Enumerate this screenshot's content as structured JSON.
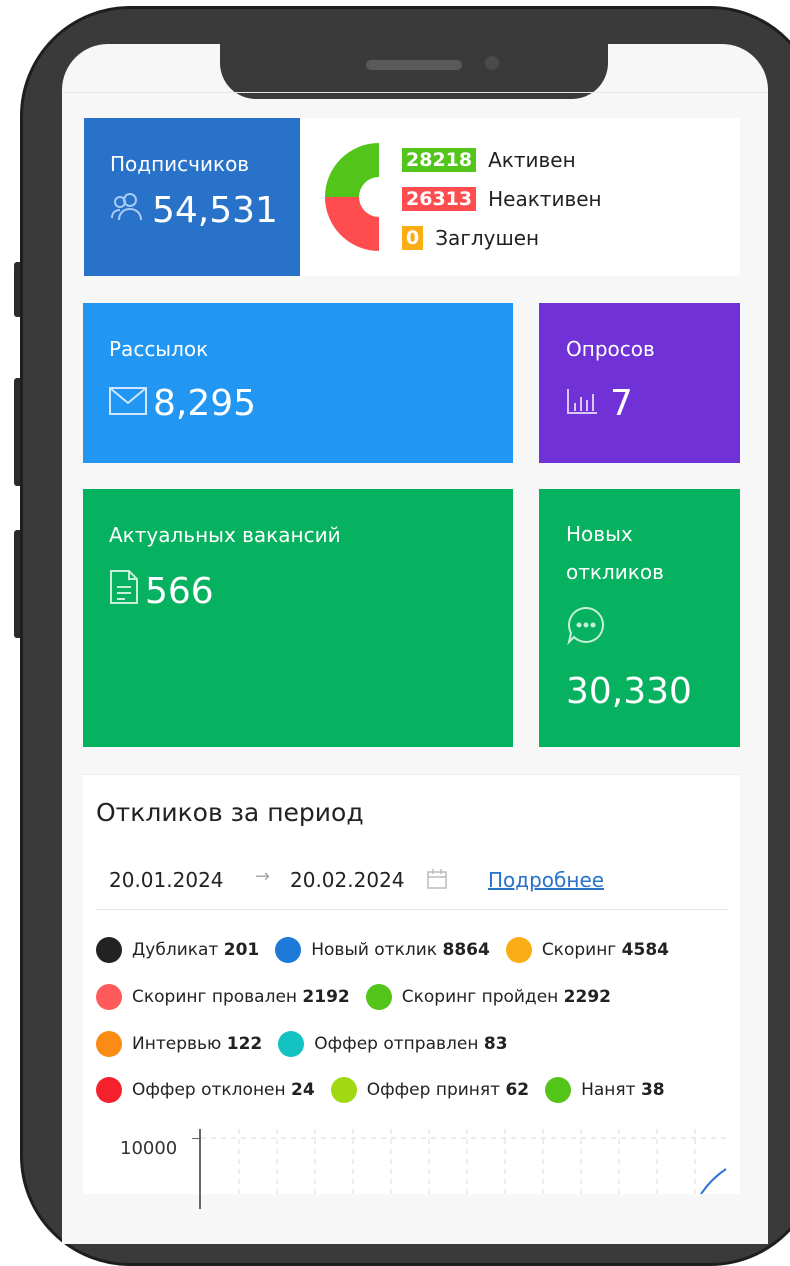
{
  "subscribers": {
    "label": "Подписчиков",
    "value": "54,531"
  },
  "subscriber_status": [
    {
      "value": "28218",
      "label": "Активен",
      "color": "#52c41a"
    },
    {
      "value": "26313",
      "label": "Неактивен",
      "color": "#ff4d4f"
    },
    {
      "value": "0",
      "label": "Заглушен",
      "color": "#faad14"
    }
  ],
  "mailings": {
    "label": "Рассылок",
    "value": "8,295"
  },
  "polls": {
    "label": "Опросов",
    "value": "7"
  },
  "vacancies": {
    "label": "Актуальных вакансий",
    "value": "566"
  },
  "responses": {
    "label_line1": "Новых",
    "label_line2": "откликов",
    "value": "30,330"
  },
  "period": {
    "title": "Откликов за период",
    "date_from": "20.01.2024",
    "date_to": "20.02.2024",
    "more_link": "Подробнее"
  },
  "response_stats": [
    {
      "label": "Дубликат",
      "value": "201",
      "color": "#222222"
    },
    {
      "label": "Новый отклик",
      "value": "8864",
      "color": "#1e7ad8"
    },
    {
      "label": "Скоринг",
      "value": "4584",
      "color": "#faad14"
    },
    {
      "label": "Скоринг провален",
      "value": "2192",
      "color": "#ff5a5a"
    },
    {
      "label": "Скоринг пройден",
      "value": "2292",
      "color": "#52c41a"
    },
    {
      "label": "Интервью",
      "value": "122",
      "color": "#fa8c16"
    },
    {
      "label": "Оффер отправлен",
      "value": "83",
      "color": "#13c2c2"
    },
    {
      "label": "Оффер отклонен",
      "value": "24",
      "color": "#f5222d"
    },
    {
      "label": "Оффер принят",
      "value": "62",
      "color": "#a0d911"
    },
    {
      "label": "Нанят",
      "value": "38",
      "color": "#52c41a"
    }
  ],
  "chart_axis_top": "10000"
}
